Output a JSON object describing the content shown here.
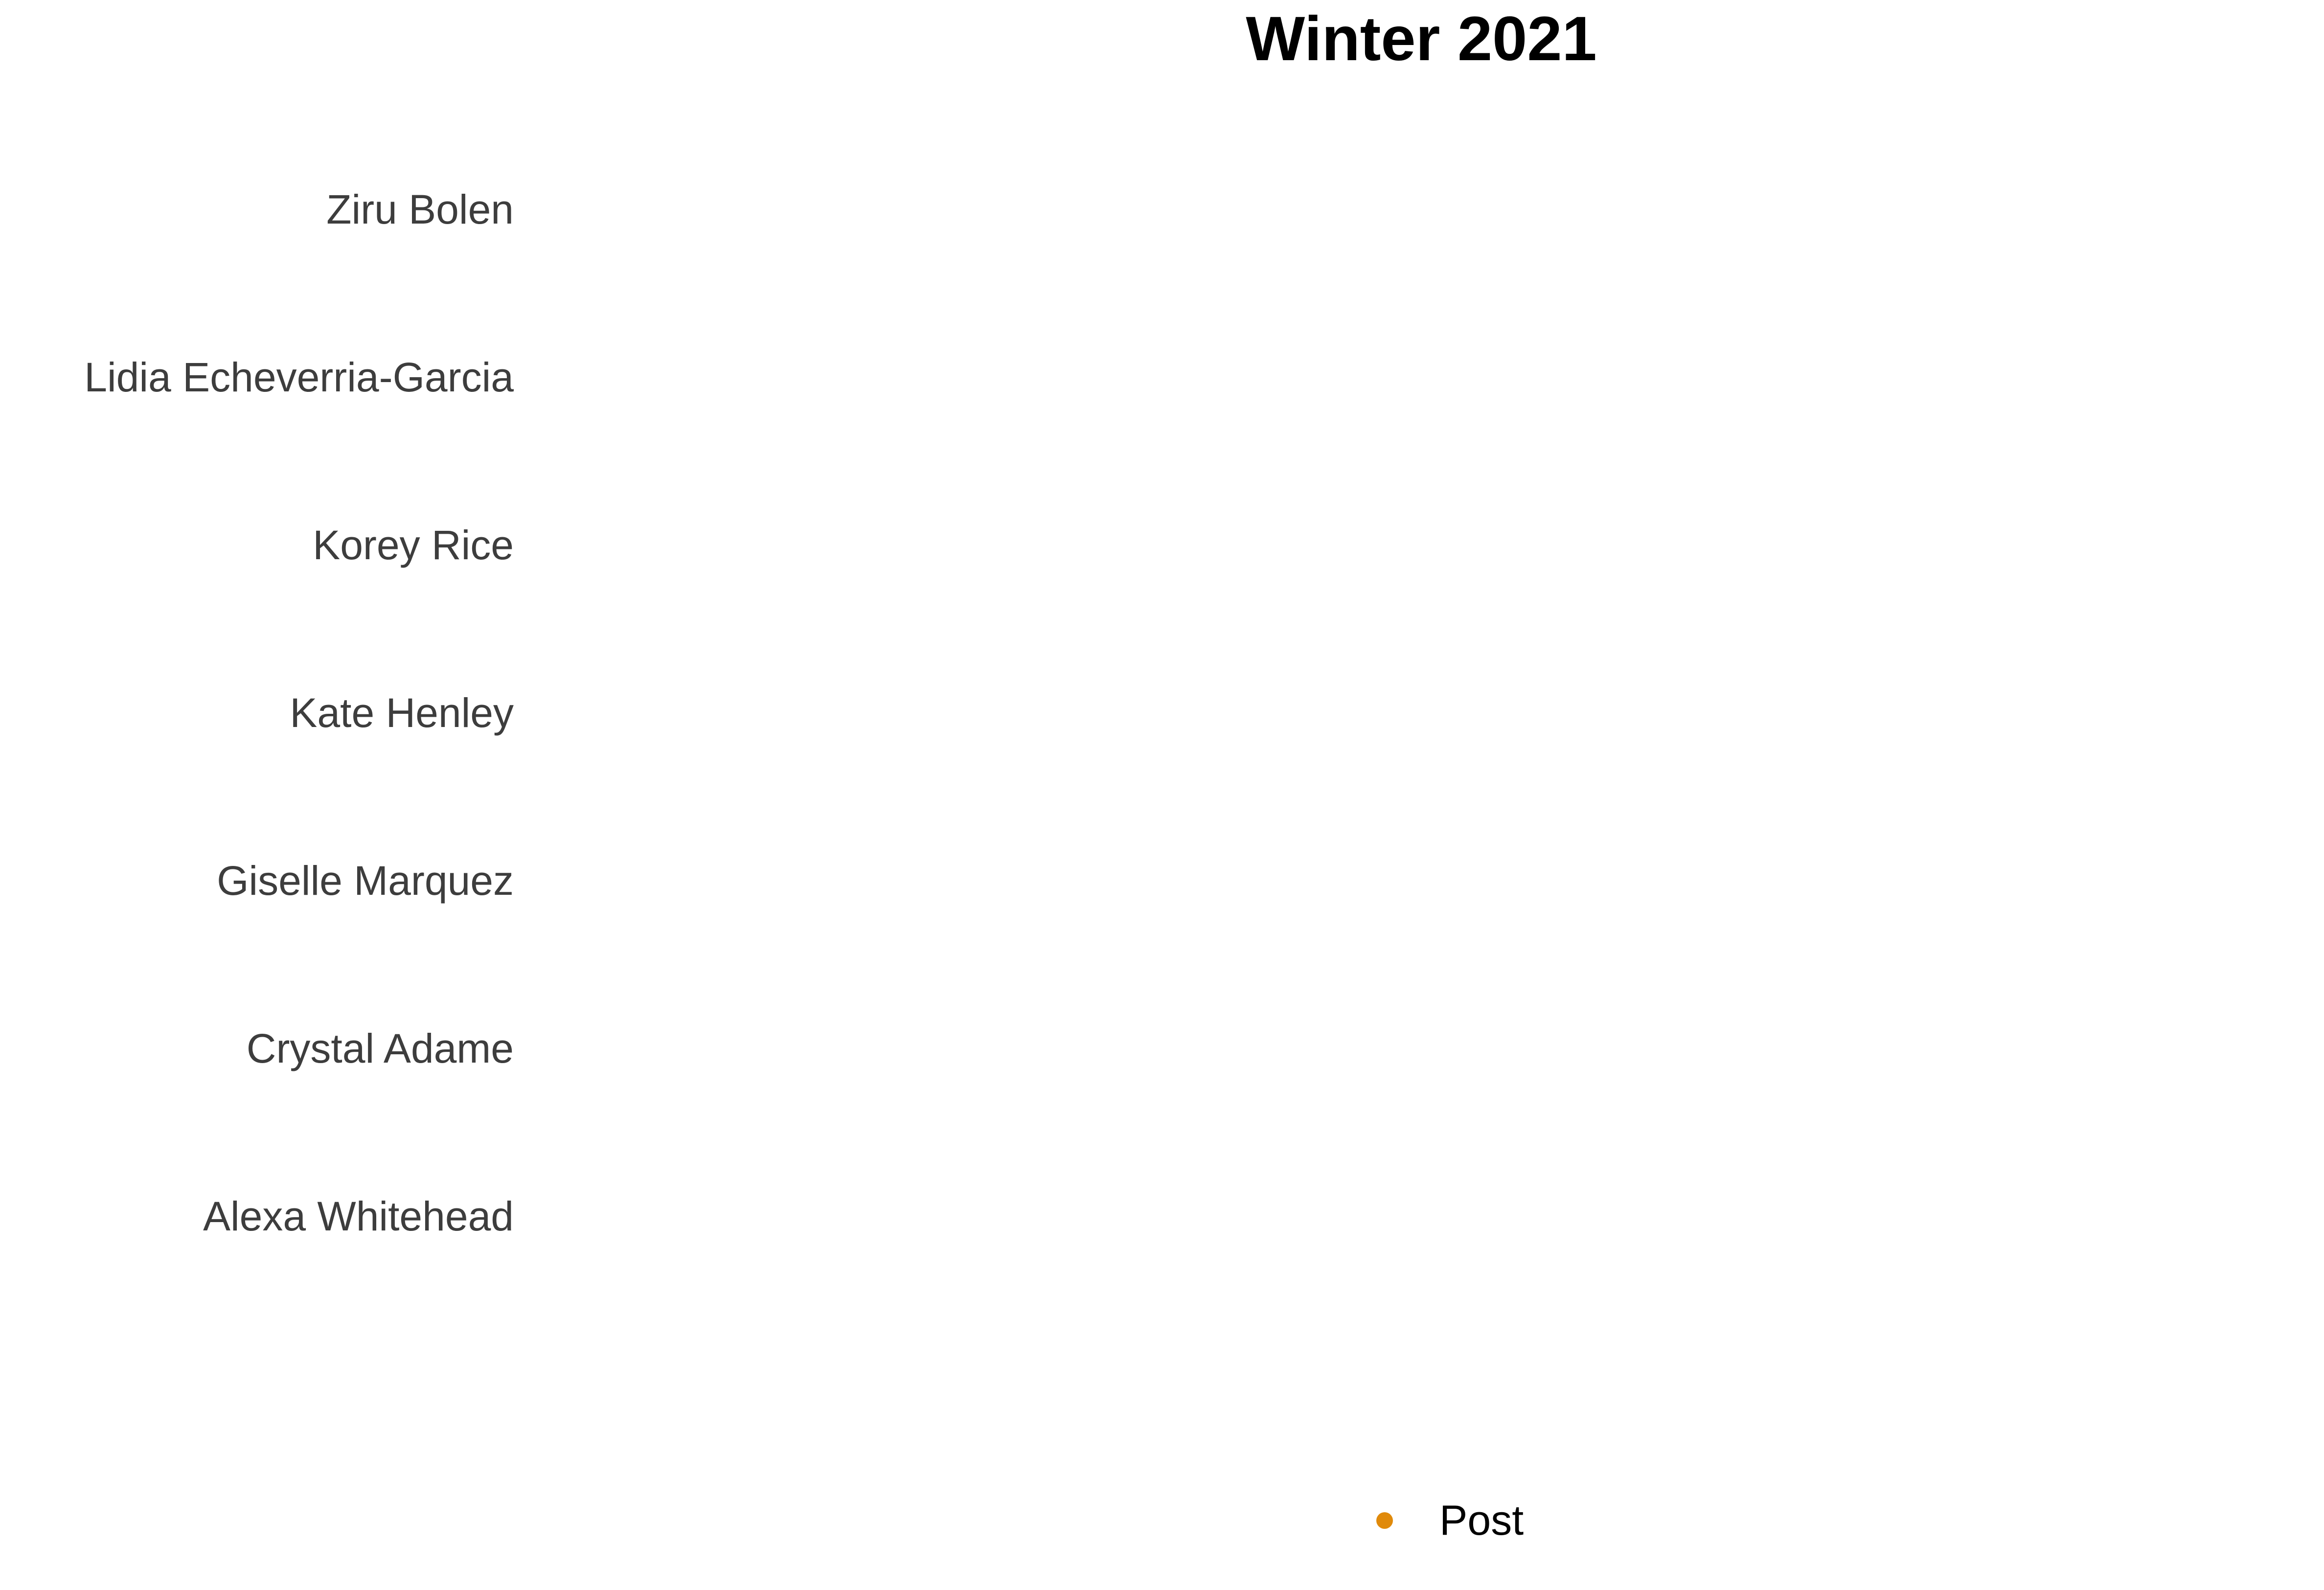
{
  "chart_data": {
    "type": "scatter",
    "title": "Winter 2021",
    "xlabel": "",
    "ylabel": "",
    "categories": [
      "Ziru Bolen",
      "Lidia Echeverria-Garcia",
      "Korey Rice",
      "Kate Henley",
      "Giselle Marquez",
      "Crystal Adame",
      "Alexa Whitehead"
    ],
    "series": [
      {
        "name": "Post",
        "color": "#E08A0B",
        "values": []
      }
    ],
    "grid": false,
    "legend_position": "bottom"
  }
}
